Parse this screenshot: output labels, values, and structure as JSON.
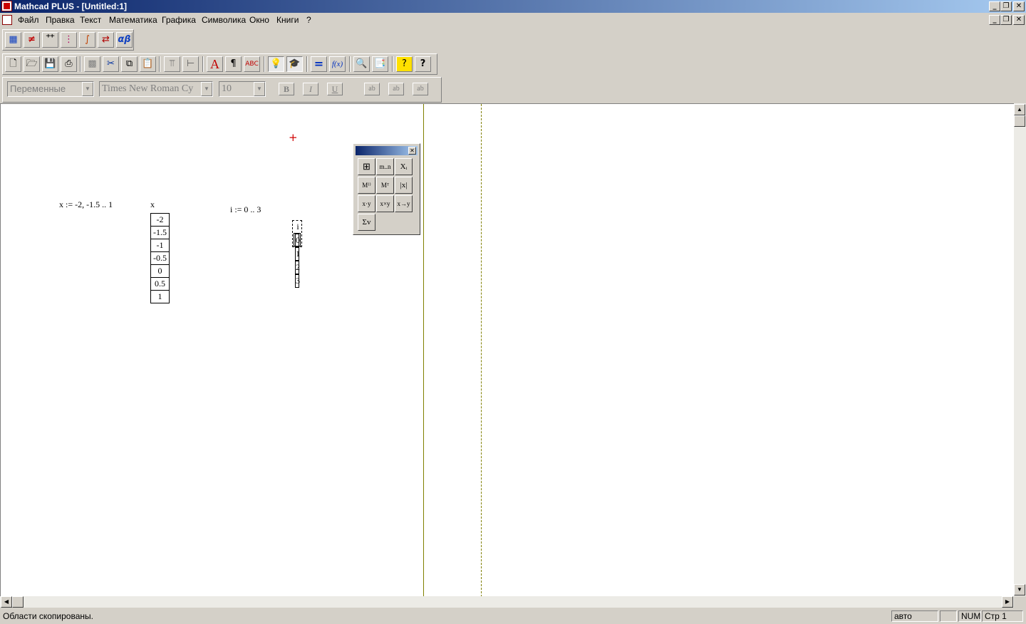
{
  "window": {
    "title": "Mathcad PLUS - [Untitled:1]"
  },
  "menu": [
    "Файл",
    "Правка",
    "Текст",
    "Математика",
    "Графика",
    "Символика",
    "Окно",
    "Книги",
    "?"
  ],
  "format_toolbar": {
    "style_value": "Переменные",
    "font_value": "Times New Roman Cy",
    "size_value": "10",
    "bold_label": "B",
    "italic_label": "I",
    "underline_label": "U"
  },
  "worksheet": {
    "x_definition": "x := -2, -1.5 .. 1",
    "x_label": "x",
    "x_values": [
      "-2",
      "-1.5",
      "-1",
      "-0.5",
      "0",
      "0.5",
      "1"
    ],
    "i_definition": "i := 0 .. 3",
    "i_label": "i",
    "i_values": [
      "0",
      "1",
      "2",
      "3"
    ],
    "cursor_glyph": "+"
  },
  "matrix_palette": {
    "buttons": [
      "matrix",
      "m..n",
      "Xᵢ",
      "M⁽⁾",
      "Mᵀ",
      "|x|",
      "x·y",
      "x×y",
      "x→y",
      "Σv"
    ]
  },
  "status": {
    "message": "Области скопированы.",
    "calc_mode": "авто",
    "num": "NUM",
    "page": "Стр 1"
  }
}
